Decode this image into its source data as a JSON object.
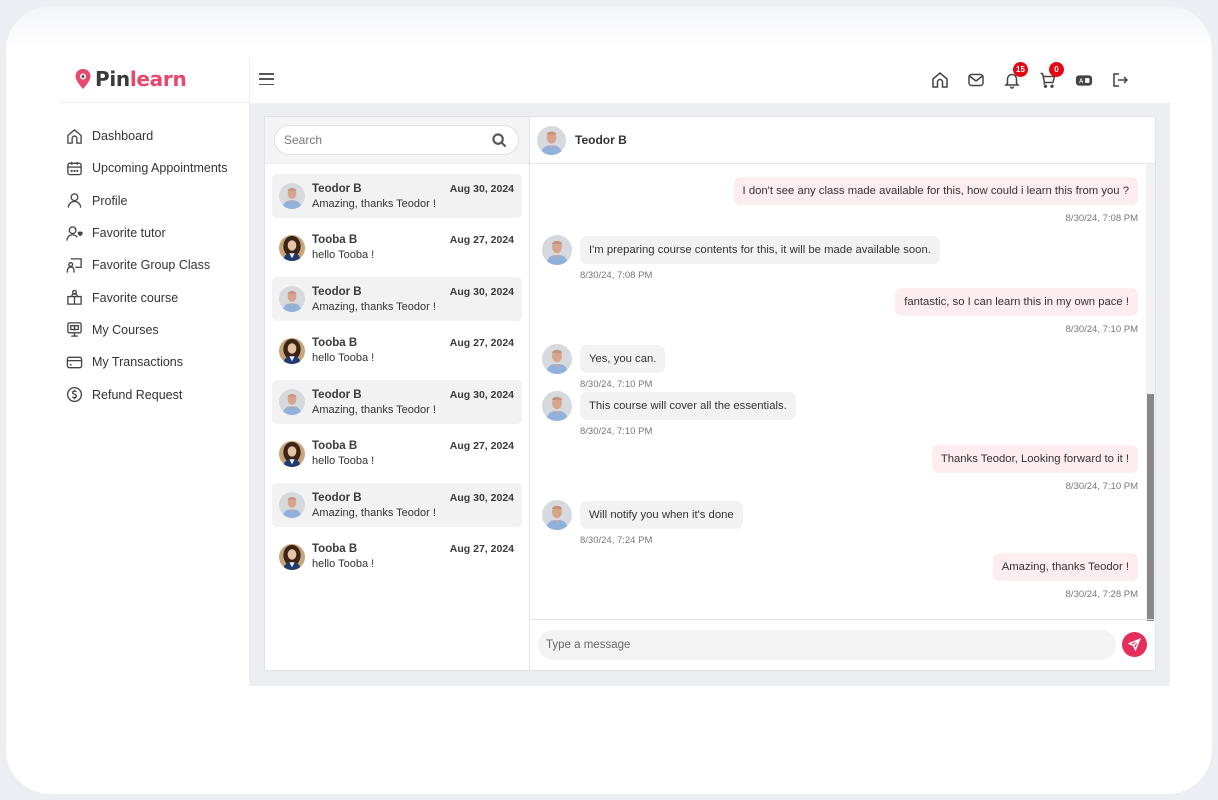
{
  "brand": {
    "name_part1": "Pin",
    "name_part2": "learn",
    "accent_color": "#e8476e"
  },
  "sidebar": {
    "items": [
      {
        "label": "Dashboard",
        "icon": "home-icon"
      },
      {
        "label": "Upcoming Appointments",
        "icon": "calendar-icon"
      },
      {
        "label": "Profile",
        "icon": "user-icon"
      },
      {
        "label": "Favorite tutor",
        "icon": "user-heart-icon"
      },
      {
        "label": "Favorite Group Class",
        "icon": "presentation-icon"
      },
      {
        "label": "Favorite course",
        "icon": "course-icon"
      },
      {
        "label": "My Courses",
        "icon": "monitor-book-icon"
      },
      {
        "label": "My Transactions",
        "icon": "credit-card-icon"
      },
      {
        "label": "Refund Request",
        "icon": "dollar-circle-icon"
      }
    ]
  },
  "topbar": {
    "menu_icon": "hamburger-icon",
    "icons": [
      {
        "name": "home-icon"
      },
      {
        "name": "mail-icon"
      },
      {
        "name": "bell-icon",
        "badge": "15"
      },
      {
        "name": "cart-icon",
        "badge": "0"
      },
      {
        "name": "language-icon"
      },
      {
        "name": "logout-icon"
      }
    ],
    "badge_color": "#e30613"
  },
  "conversations": {
    "search_placeholder": "Search",
    "items": [
      {
        "name": "Teodor B",
        "date": "Aug 30, 2024",
        "preview": "Amazing, thanks Teodor !",
        "avatar": "teodor"
      },
      {
        "name": "Tooba B",
        "date": "Aug 27, 2024",
        "preview": "hello Tooba !",
        "avatar": "tooba"
      },
      {
        "name": "Teodor B",
        "date": "Aug 30, 2024",
        "preview": "Amazing, thanks Teodor !",
        "avatar": "teodor"
      },
      {
        "name": "Tooba B",
        "date": "Aug 27, 2024",
        "preview": "hello Tooba !",
        "avatar": "tooba"
      },
      {
        "name": "Teodor B",
        "date": "Aug 30, 2024",
        "preview": "Amazing, thanks Teodor !",
        "avatar": "teodor"
      },
      {
        "name": "Tooba B",
        "date": "Aug 27, 2024",
        "preview": "hello Tooba !",
        "avatar": "tooba"
      },
      {
        "name": "Teodor B",
        "date": "Aug 30, 2024",
        "preview": "Amazing, thanks Teodor !",
        "avatar": "teodor"
      },
      {
        "name": "Tooba B",
        "date": "Aug 27, 2024",
        "preview": "hello Tooba !",
        "avatar": "tooba"
      }
    ]
  },
  "chat": {
    "contact_name": "Teodor B",
    "messages": [
      {
        "direction": "out",
        "text": "I don't see any class made available for this, how could i learn this from you ?",
        "time": "8/30/24, 7:08 PM"
      },
      {
        "direction": "in",
        "text": "I'm preparing course contents for this, it will be made available soon.",
        "time": "8/30/24, 7:08 PM"
      },
      {
        "direction": "out",
        "text": "fantastic, so I can learn this in my own pace !",
        "time": "8/30/24, 7:10 PM"
      },
      {
        "direction": "in",
        "text": "Yes, you can.",
        "time": "8/30/24, 7:10 PM"
      },
      {
        "direction": "in",
        "text": "This course will cover all the essentials.",
        "time": "8/30/24, 7:10 PM"
      },
      {
        "direction": "out",
        "text": "Thanks Teodor, Looking forward to it !",
        "time": "8/30/24, 7:10 PM"
      },
      {
        "direction": "in",
        "text": "Will notify you when it's done",
        "time": "8/30/24, 7:24 PM"
      },
      {
        "direction": "out",
        "text": "Amazing, thanks Teodor !",
        "time": "8/30/24, 7:28 PM"
      }
    ],
    "composer_placeholder": "Type a message",
    "send_icon": "send-icon",
    "send_color": "#e62e5c",
    "outgoing_bubble_color": "#fdecf0",
    "incoming_bubble_color": "#f2f2f2"
  }
}
